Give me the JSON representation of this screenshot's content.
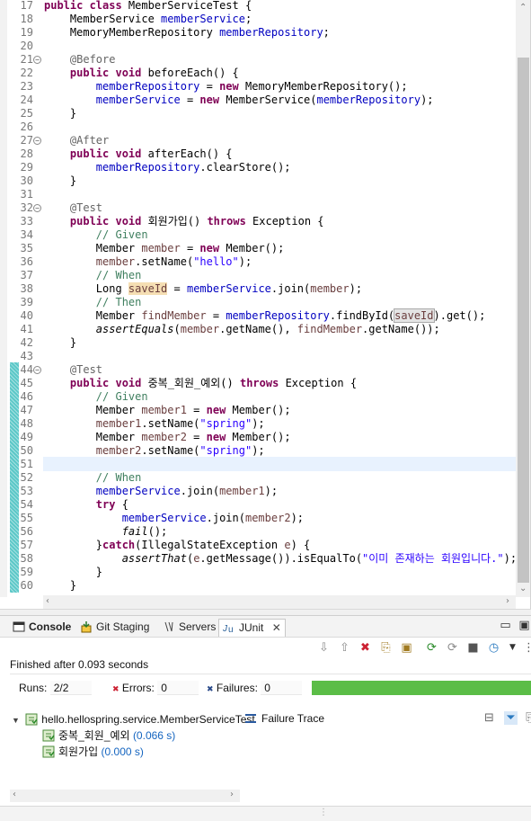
{
  "editor": {
    "lines": [
      {
        "n": "17",
        "html": "<span class=\"kw\">public class</span> MemberServiceTest {"
      },
      {
        "n": "18",
        "html": "    MemberService <span class=\"fld\">memberService</span>;"
      },
      {
        "n": "19",
        "html": "    MemoryMemberRepository <span class=\"fld\">memberRepository</span>;"
      },
      {
        "n": "20",
        "html": ""
      },
      {
        "n": "21",
        "fold": "−",
        "html": "    <span class=\"ann\">@Before</span>"
      },
      {
        "n": "22",
        "html": "    <span class=\"kw\">public void</span> beforeEach() {"
      },
      {
        "n": "23",
        "html": "        <span class=\"fld\">memberRepository</span> = <span class=\"kw\">new</span> MemoryMemberRepository();"
      },
      {
        "n": "24",
        "html": "        <span class=\"fld\">memberService</span> = <span class=\"kw\">new</span> MemberService(<span class=\"fld\">memberRepository</span>);"
      },
      {
        "n": "25",
        "html": "    }"
      },
      {
        "n": "26",
        "html": ""
      },
      {
        "n": "27",
        "fold": "−",
        "html": "    <span class=\"ann\">@After</span>"
      },
      {
        "n": "28",
        "html": "    <span class=\"kw\">public void</span> afterEach() {"
      },
      {
        "n": "29",
        "html": "        <span class=\"fld\">memberRepository</span>.clearStore();"
      },
      {
        "n": "30",
        "html": "    }"
      },
      {
        "n": "31",
        "html": ""
      },
      {
        "n": "32",
        "fold": "−",
        "html": "    <span class=\"ann\">@Test</span>"
      },
      {
        "n": "33",
        "html": "    <span class=\"kw\">public void</span> 회원가입() <span class=\"kw\">throws</span> Exception {"
      },
      {
        "n": "34",
        "html": "        <span class=\"cm\">// Given</span>"
      },
      {
        "n": "35",
        "html": "        Member <span class=\"var\">member</span> = <span class=\"kw\">new</span> Member();"
      },
      {
        "n": "36",
        "html": "        <span class=\"var\">member</span>.setName(<span class=\"str\">\"hello\"</span>);"
      },
      {
        "n": "37",
        "html": "        <span class=\"cm\">// When</span>"
      },
      {
        "n": "38",
        "html": "        Long <span class=\"var hl\">saveId</span> = <span class=\"fld\">memberService</span>.join(<span class=\"var\">member</span>);"
      },
      {
        "n": "39",
        "html": "        <span class=\"cm\">// Then</span>"
      },
      {
        "n": "40",
        "html": "        Member <span class=\"var\">findMember</span> = <span class=\"fld\">memberRepository</span>.findById(<span class=\"var hb\">saveId</span>).get();"
      },
      {
        "n": "41",
        "html": "        <span class=\"it\">assertEquals</span>(<span class=\"var\">member</span>.getName(), <span class=\"var\">findMember</span>.getName());"
      },
      {
        "n": "42",
        "html": "    }"
      },
      {
        "n": "43",
        "html": ""
      },
      {
        "n": "44",
        "fold": "−",
        "html": "    <span class=\"ann\">@Test</span>"
      },
      {
        "n": "45",
        "html": "    <span class=\"kw\">public void</span> 중복_회원_예외() <span class=\"kw\">throws</span> Exception {"
      },
      {
        "n": "46",
        "html": "        <span class=\"cm\">// Given</span>"
      },
      {
        "n": "47",
        "html": "        Member <span class=\"var\">member1</span> = <span class=\"kw\">new</span> Member();"
      },
      {
        "n": "48",
        "html": "        <span class=\"var\">member1</span>.setName(<span class=\"str\">\"spring\"</span>);"
      },
      {
        "n": "49",
        "html": "        Member <span class=\"var\">member2</span> = <span class=\"kw\">new</span> Member();"
      },
      {
        "n": "50",
        "html": "        <span class=\"var\">member2</span>.setName(<span class=\"str\">\"spring\"</span>);"
      },
      {
        "n": "51",
        "html": ""
      },
      {
        "n": "52",
        "html": "        <span class=\"cm\">// When</span>"
      },
      {
        "n": "53",
        "html": "        <span class=\"fld\">memberService</span>.join(<span class=\"var\">member1</span>);"
      },
      {
        "n": "54",
        "html": "        <span class=\"kw\">try</span> {"
      },
      {
        "n": "55",
        "html": "            <span class=\"fld\">memberService</span>.join(<span class=\"var\">member2</span>);"
      },
      {
        "n": "56",
        "html": "            <span class=\"it\">fail</span>();"
      },
      {
        "n": "57",
        "html": "        }<span class=\"kw\">catch</span>(IllegalStateException <span class=\"var\">e</span>) {"
      },
      {
        "n": "58",
        "html": "            <span class=\"it\">assertThat</span>(<span class=\"var\">e</span>.getMessage()).isEqualTo(<span class=\"str\">\"이미 존재하는 회원입니다.\"</span>);"
      },
      {
        "n": "59",
        "html": "        }"
      },
      {
        "n": "60",
        "html": "    }"
      }
    ]
  },
  "tabs": {
    "console": "Console",
    "git": "Git Staging",
    "servers": "Servers",
    "junit": "JUnit"
  },
  "junit": {
    "finished": "Finished after 0.093 seconds",
    "runs_label": "Runs:",
    "runs": "2/2",
    "errors_label": "Errors:",
    "errors": "0",
    "failures_label": "Failures:",
    "failures": "0",
    "progress": 1.0,
    "progress_color": "#5bbd47",
    "suite": "hello.hellospring.service.MemberServiceTest",
    "tests": [
      {
        "name": "중복_회원_예외",
        "time": "(0.066 s)"
      },
      {
        "name": "회원가입",
        "time": "(0.000 s)"
      }
    ],
    "trace_title": "Failure Trace"
  }
}
